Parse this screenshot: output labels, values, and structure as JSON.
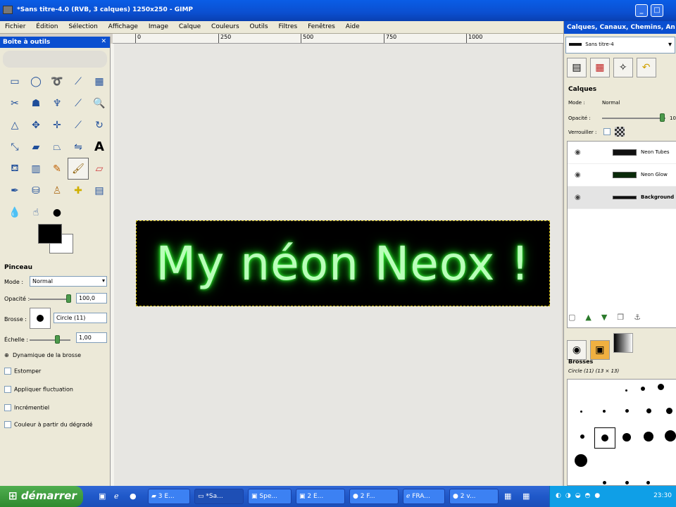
{
  "window": {
    "title": "*Sans titre-4.0 (RVB, 3 calques) 1250x250 - GIMP"
  },
  "menu": [
    "Fichier",
    "Édition",
    "Sélection",
    "Affichage",
    "Image",
    "Calque",
    "Couleurs",
    "Outils",
    "Filtres",
    "Fenêtres",
    "Aide"
  ],
  "toolbox": {
    "title": "Boîte à outils",
    "options": {
      "tool_name": "Pinceau",
      "mode_label": "Mode :",
      "mode_value": "Normal",
      "opacity_label": "Opacité :",
      "opacity_value": "100,0",
      "brush_label": "Brosse :",
      "brush_value": "Circle (11)",
      "scale_label": "Échelle :",
      "scale_value": "1,00",
      "checks": [
        "Dynamique de la brosse",
        "Estomper",
        "Appliquer fluctuation",
        "Incrémentiel",
        "Couleur à partir du dégradé"
      ]
    }
  },
  "ruler": {
    "ticks": [
      "0",
      "250",
      "500",
      "750",
      "1000"
    ]
  },
  "canvas": {
    "text": "My néon Neox !",
    "glow_color": "#3cff3c"
  },
  "dock": {
    "title": "Calques, Canaux, Chemins, An",
    "image_select": "Sans titre-4",
    "layers_title": "Calques",
    "mode_label": "Mode :",
    "mode_value": "Normal",
    "opacity_label": "Opacité :",
    "opacity_value": "10",
    "lock_label": "Verrouiller :",
    "layers": [
      {
        "name": "Neon Tubes",
        "selected": false
      },
      {
        "name": "Neon Glow",
        "selected": false
      },
      {
        "name": "Background",
        "selected": true
      }
    ],
    "brushes_title": "Brosses",
    "brush_current": "Circle (11) (13 × 13)"
  },
  "taskbar": {
    "start": "démarrer",
    "tasks": [
      "3 E...",
      "*Sa...",
      "Spe...",
      "2 E...",
      "2 F...",
      "FRA...",
      "2 v..."
    ],
    "clock": "23:30"
  }
}
